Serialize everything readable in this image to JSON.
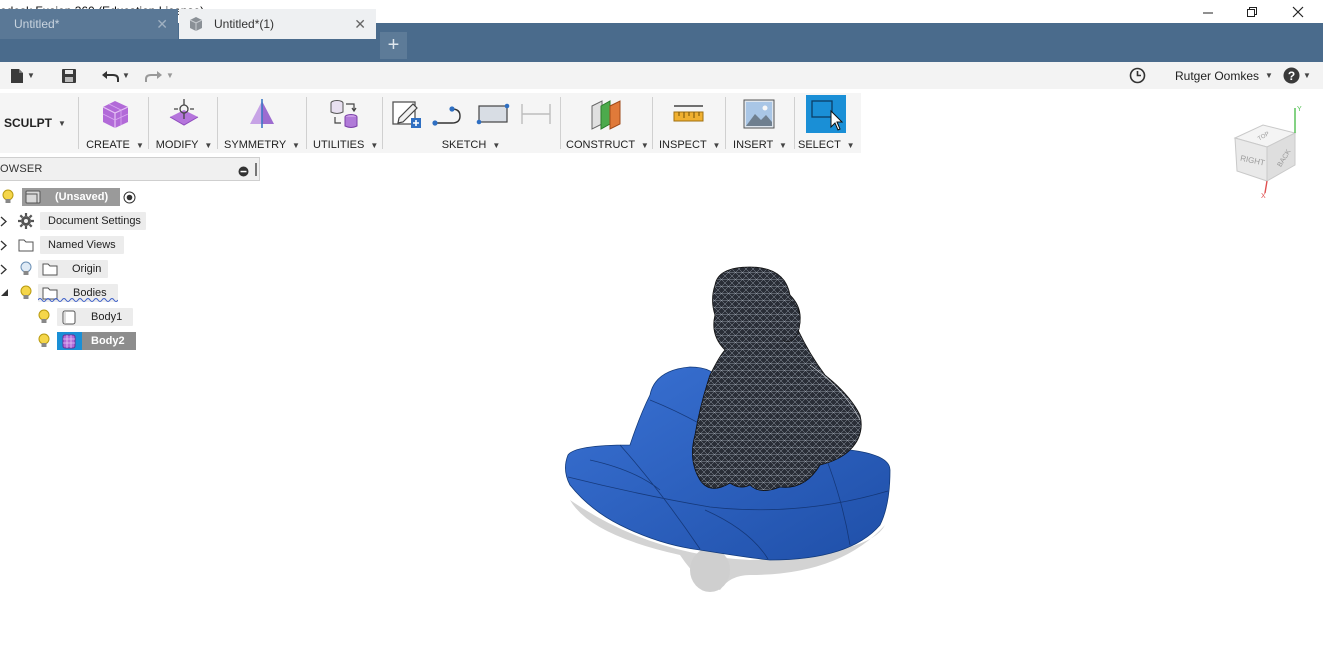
{
  "window": {
    "title": "odesk Fusion 360 (Education License)"
  },
  "tabs": [
    {
      "label": "Untitled*",
      "active": false
    },
    {
      "label": "Untitled*(1)",
      "active": true
    }
  ],
  "quick_access": {
    "user_name": "Rutger Oomkes"
  },
  "toolbar": {
    "workspace": "SCULPT",
    "groups": [
      {
        "label": "CREATE",
        "icon": "box-icon"
      },
      {
        "label": "MODIFY",
        "icon": "modify-icon"
      },
      {
        "label": "SYMMETRY",
        "icon": "symmetry-icon"
      },
      {
        "label": "UTILITIES",
        "icon": "utilities-icon"
      },
      {
        "label": "SKETCH",
        "icon": "sketch-icon"
      },
      {
        "label": "CONSTRUCT",
        "icon": "construct-icon"
      },
      {
        "label": "INSPECT",
        "icon": "measure-icon"
      },
      {
        "label": "INSERT",
        "icon": "image-icon"
      },
      {
        "label": "SELECT",
        "icon": "select-icon"
      }
    ]
  },
  "browser": {
    "title": "OWSER",
    "root": "(Unsaved)",
    "items": [
      {
        "label": "Document Settings"
      },
      {
        "label": "Named Views"
      },
      {
        "label": "Origin"
      },
      {
        "label": "Bodies"
      }
    ],
    "bodies": [
      {
        "label": "Body1"
      },
      {
        "label": "Body2",
        "selected": true
      }
    ]
  },
  "viewcube": {
    "faces": [
      "RIGHT",
      "BACK",
      "TOP"
    ]
  },
  "colors": {
    "tab_strip": "#4a6b8c",
    "body_blue": "#2a5fc0",
    "mesh_dark": "#1c1f26",
    "select_blue": "#1a8fd6"
  }
}
